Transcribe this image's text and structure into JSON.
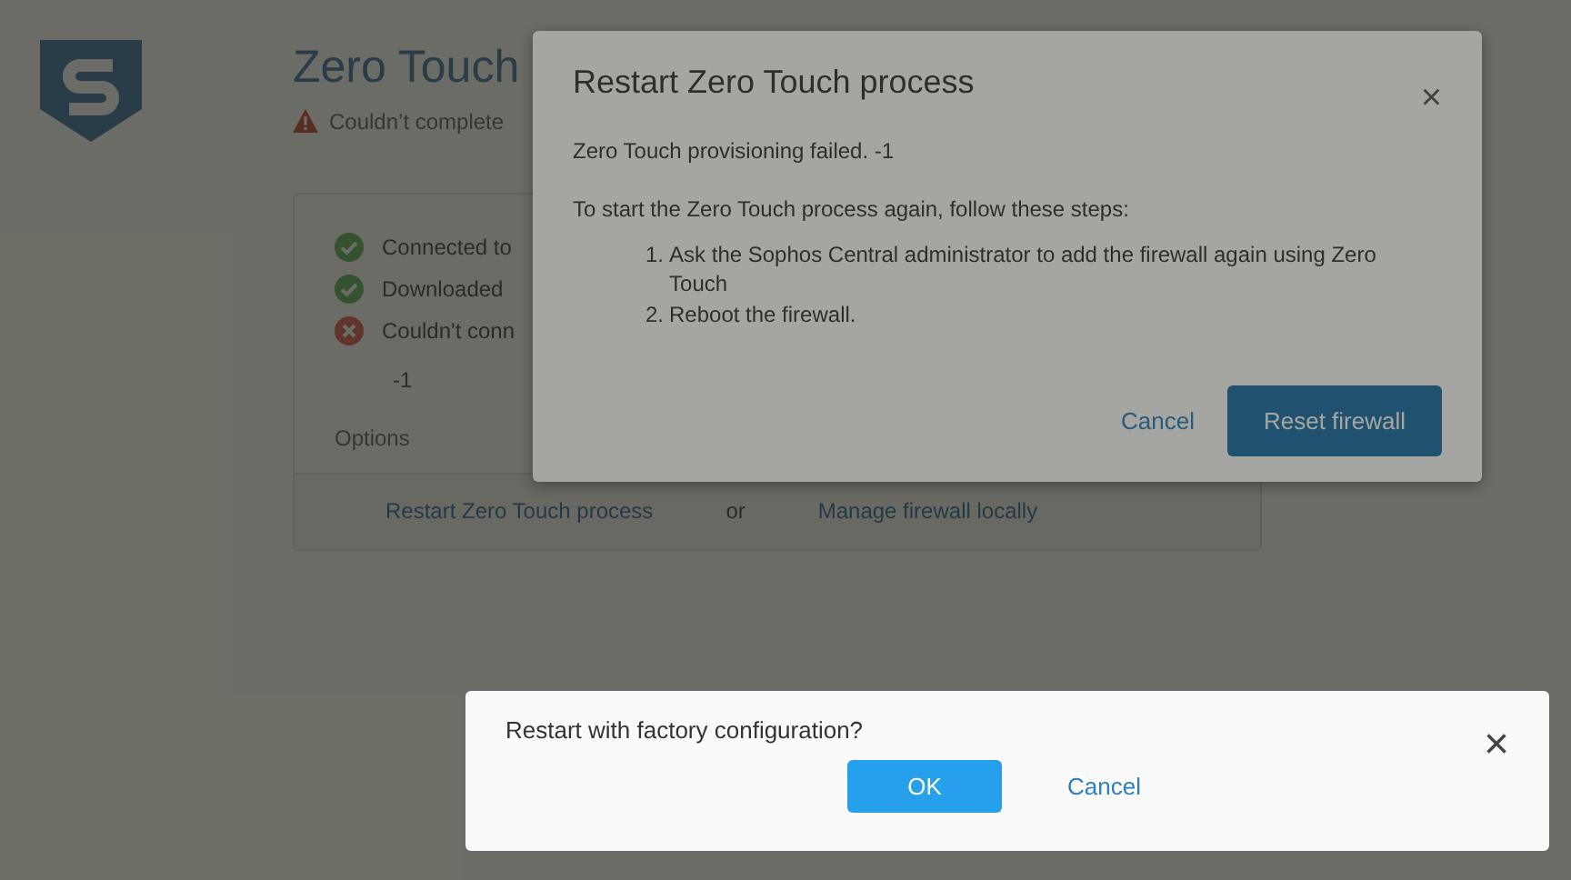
{
  "page": {
    "title": "Zero Touch",
    "alert": "Couldn’t complete",
    "steps": [
      {
        "kind": "ok",
        "text": "Connected to"
      },
      {
        "kind": "ok",
        "text": "Downloaded"
      },
      {
        "kind": "error",
        "text": "Couldn't conn"
      }
    ],
    "step_detail": "-1",
    "options_label": "Options",
    "options": [
      {
        "kind": "link",
        "text": "Restart Zero Touch process"
      },
      {
        "kind": "text",
        "text": "or"
      },
      {
        "kind": "link",
        "text": "Manage firewall locally"
      }
    ]
  },
  "modal": {
    "title": "Restart Zero Touch process",
    "close": "×",
    "message": "Zero Touch provisioning failed. -1",
    "intro": "To start the Zero Touch process again, follow these steps:",
    "steps": [
      {
        "marker": "1.",
        "text": "Ask the Sophos Central administrator to add the firewall again using Zero Touch"
      },
      {
        "marker": "2.",
        "text": "Reboot the firewall."
      }
    ],
    "cancel": "Cancel",
    "primary": "Reset firewall"
  },
  "confirm": {
    "message": "Restart with factory configuration?",
    "close": "×",
    "ok": "OK",
    "cancel": "Cancel"
  }
}
